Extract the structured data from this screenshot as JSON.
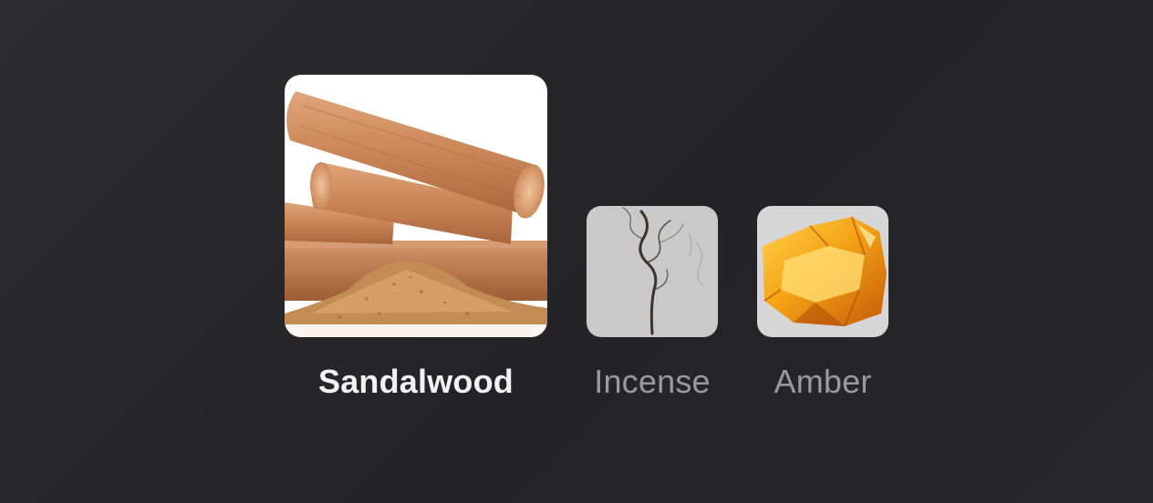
{
  "options": [
    {
      "label": "Sandalwood",
      "selected": true,
      "image": "sandalwood-logs-image"
    },
    {
      "label": "Incense",
      "selected": false,
      "image": "incense-smoke-image"
    },
    {
      "label": "Amber",
      "selected": false,
      "image": "amber-resin-image"
    }
  ],
  "colors": {
    "background": "#262629",
    "selected_label": "#f2f2f2",
    "unselected_label": "#9a9a9c"
  }
}
